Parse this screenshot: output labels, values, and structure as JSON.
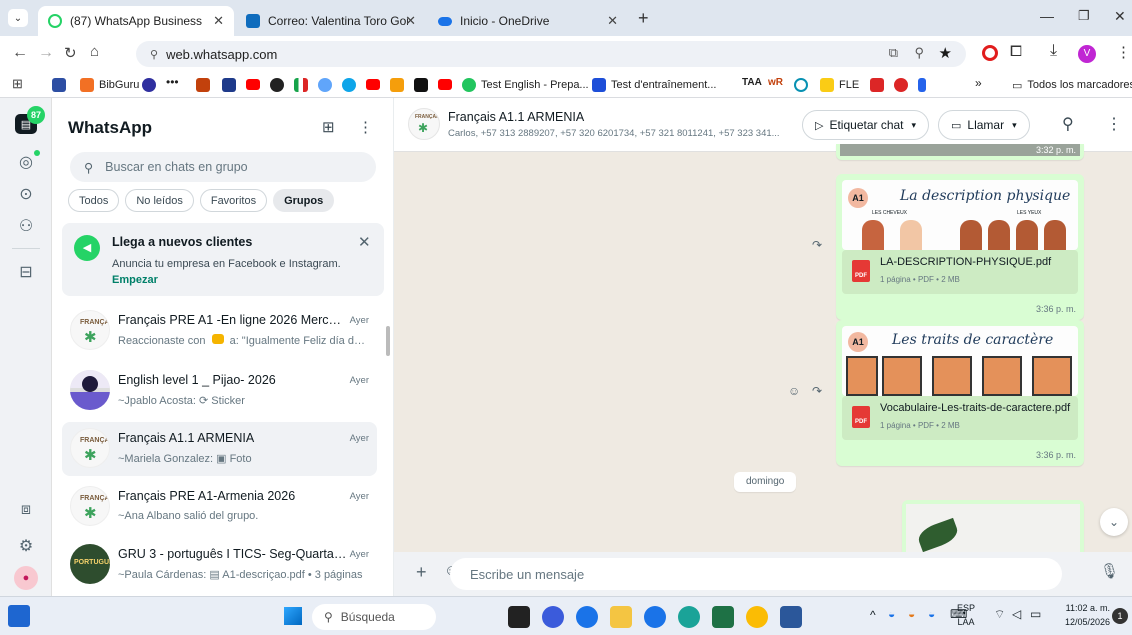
{
  "browser": {
    "tabs": [
      {
        "label": "(87) WhatsApp Business",
        "icon": "whatsapp-icon"
      },
      {
        "label": "Correo: Valentina Toro Gomez",
        "icon": "outlook-icon"
      },
      {
        "label": "Inicio - OneDrive",
        "icon": "onedrive-icon"
      }
    ],
    "url": "web.whatsapp.com",
    "bookmarks": [
      "BibGuru",
      "Test English - Prepa...",
      "Test d'entraînement...",
      "FLE",
      "Todos los marcadores"
    ]
  },
  "whatsapp": {
    "badge": "87",
    "title": "WhatsApp",
    "search_placeholder": "Buscar en chats en grupo",
    "filters": [
      "Todos",
      "No leídos",
      "Favoritos",
      "Grupos"
    ],
    "promo": {
      "title": "Llega a nuevos clientes",
      "text": "Anuncia tu empresa en Facebook e Instagram.",
      "cta": "Empezar"
    },
    "chats": [
      {
        "name": "Français PRE A1 -En ligne 2026  Mercred...",
        "time": "Ayer",
        "preview_prefix": "Reaccionaste con",
        "preview_suffix": "a: \"Igualmente Feliz día de l..."
      },
      {
        "name": "English level 1 _ Pijao- 2026",
        "time": "Ayer",
        "preview": "~Jpablo Acosta: ⟳ Sticker"
      },
      {
        "name": "Français A1.1 ARMENIA",
        "time": "Ayer",
        "preview": "~Mariela Gonzalez: ▣ Foto"
      },
      {
        "name": "Français PRE A1-Armenia 2026",
        "time": "Ayer",
        "preview": "~Ana Albano salió del grupo."
      },
      {
        "name": "GRU 3 - português I TICS- Seg-Quarta 10-...",
        "time": "Ayer",
        "preview": "~Paula Cárdenas: ▤ A1-descriçao.pdf • 3 páginas"
      }
    ],
    "conversation": {
      "name": "Français A1.1 ARMENIA",
      "members": "Carlos, +57 313 2889207, +57 320 6201734, +57 321 8011241, +57 323 341...",
      "label_button": "Etiquetar chat",
      "call_button": "Llamar",
      "top_time": "3:32 p. m.",
      "messages": [
        {
          "thumb_title": "La description physique",
          "thumb_tag": "A1",
          "thumb_left": "LES CHEVEUX",
          "thumb_right": "LES YEUX",
          "file": "LA-DESCRIPTION-PHYSIQUE.pdf",
          "meta": "1 página • PDF • 2 MB",
          "time": "3:36 p. m."
        },
        {
          "thumb_title": "Les traits de caractère",
          "thumb_tag": "A1",
          "file": "Vocabulaire-Les-traits-de-caractere.pdf",
          "meta": "1 página • PDF • 2 MB",
          "time": "3:36 p. m."
        }
      ],
      "day_separator": "domingo",
      "composer_placeholder": "Escribe un mensaje"
    }
  },
  "taskbar": {
    "search": "Búsqueda",
    "lang": "ESP",
    "lang2": "LAA",
    "time": "11:02 a. m.",
    "date": "12/05/2026",
    "notif_count": "1"
  }
}
